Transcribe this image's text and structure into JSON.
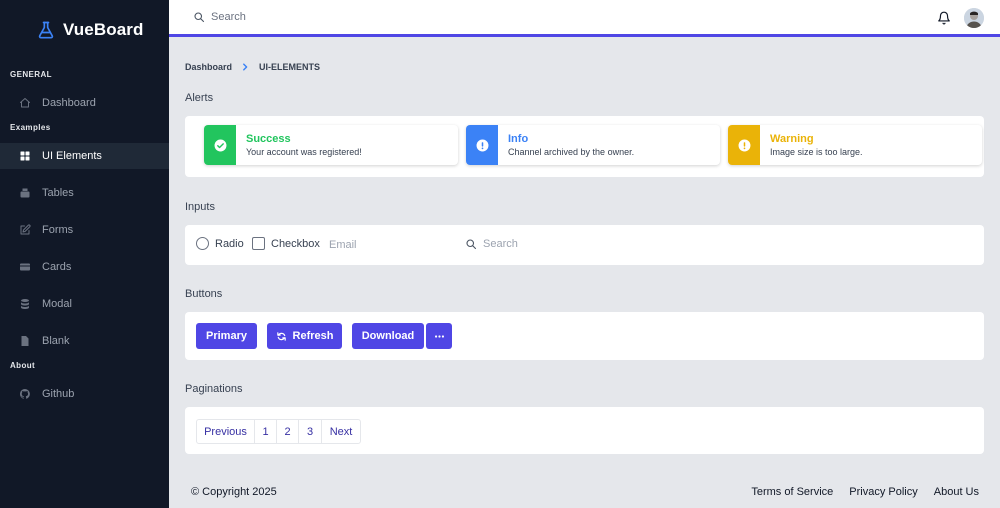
{
  "app": {
    "brand": "VueBoard",
    "accent": "#4f46e5"
  },
  "sidebar": {
    "sections": {
      "general": "GENERAL",
      "examples": "Examples",
      "about": "About"
    },
    "items": [
      {
        "label": "Dashboard",
        "icon": "home-icon",
        "active": false
      },
      {
        "label": "UI Elements",
        "icon": "grid-icon",
        "active": true
      },
      {
        "label": "Tables",
        "icon": "table-icon",
        "active": false
      },
      {
        "label": "Forms",
        "icon": "edit-icon",
        "active": false
      },
      {
        "label": "Cards",
        "icon": "card-icon",
        "active": false
      },
      {
        "label": "Modal",
        "icon": "database-icon",
        "active": false
      },
      {
        "label": "Blank",
        "icon": "document-icon",
        "active": false
      },
      {
        "label": "Github",
        "icon": "github-icon",
        "active": false
      }
    ]
  },
  "header": {
    "search_placeholder": "Search",
    "icons": [
      "search-icon",
      "bell-icon",
      "avatar"
    ]
  },
  "breadcrumb": {
    "parent": "Dashboard",
    "current": "UI-ELEMENTS"
  },
  "sections": {
    "alerts": "Alerts",
    "inputs": "Inputs",
    "buttons": "Buttons",
    "paginations": "Paginations"
  },
  "alerts": [
    {
      "title": "Success",
      "text": "Your account was registered!",
      "color": "#22c55e",
      "icon": "check-circle-icon"
    },
    {
      "title": "Info",
      "text": "Channel archived by the owner.",
      "color": "#3b82f6",
      "icon": "info-icon"
    },
    {
      "title": "Warning",
      "text": "Image size is too large.",
      "color": "#eab308",
      "icon": "warning-icon"
    }
  ],
  "inputs": {
    "radio_label": "Radio",
    "checkbox_label": "Checkbox",
    "email_placeholder": "Email",
    "search_placeholder": "Search"
  },
  "buttons": {
    "primary": "Primary",
    "refresh": "Refresh",
    "download": "Download",
    "more_icon": "more-horizontal-icon"
  },
  "pagination": {
    "previous": "Previous",
    "pages": [
      "1",
      "2",
      "3"
    ],
    "next": "Next"
  },
  "footer": {
    "copyright": "© Copyright 2025",
    "links": [
      "Terms of Service",
      "Privacy Policy",
      "About Us"
    ]
  }
}
